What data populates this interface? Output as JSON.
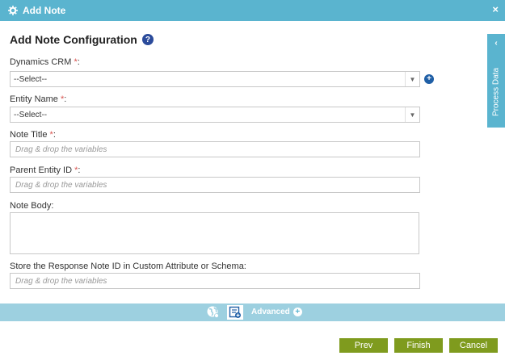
{
  "window": {
    "title": "Add Note",
    "close_glyph": "×"
  },
  "heading": {
    "text": "Add Note Configuration",
    "help_glyph": "?"
  },
  "fields": {
    "dynamics_crm": {
      "label": "Dynamics CRM",
      "required": "*",
      "colon": ":",
      "value": "--Select--"
    },
    "entity_name": {
      "label": "Entity Name",
      "required": "*",
      "colon": ":",
      "value": "--Select--"
    },
    "note_title": {
      "label": "Note Title",
      "required": "*",
      "colon": ":",
      "placeholder": "Drag & drop the variables"
    },
    "parent_entity_id": {
      "label": "Parent Entity ID",
      "required": "*",
      "colon": ":",
      "placeholder": "Drag & drop the variables"
    },
    "note_body": {
      "label": "Note Body:"
    },
    "store_response": {
      "label": "Store the Response Note ID in Custom Attribute or Schema:",
      "placeholder": "Drag & drop the variables"
    }
  },
  "add_glyph": "+",
  "process_tab": {
    "label": "Process Data",
    "chevron": "‹"
  },
  "toolbar": {
    "advanced_label": "Advanced",
    "plus_glyph": "+"
  },
  "footer": {
    "prev": "Prev",
    "finish": "Finish",
    "cancel": "Cancel"
  },
  "icons": [
    "gear-icon",
    "close-icon",
    "help-icon",
    "dropdown-arrow-icon",
    "add-circle-icon",
    "chevron-left-icon",
    "globe-icon",
    "form-icon",
    "plus-circle-icon"
  ],
  "colors": {
    "header": "#5ab4cf",
    "toolbar": "#9dd0e0",
    "button": "#7f9b1e",
    "required": "#d9534f",
    "help": "#2b4b9b"
  }
}
